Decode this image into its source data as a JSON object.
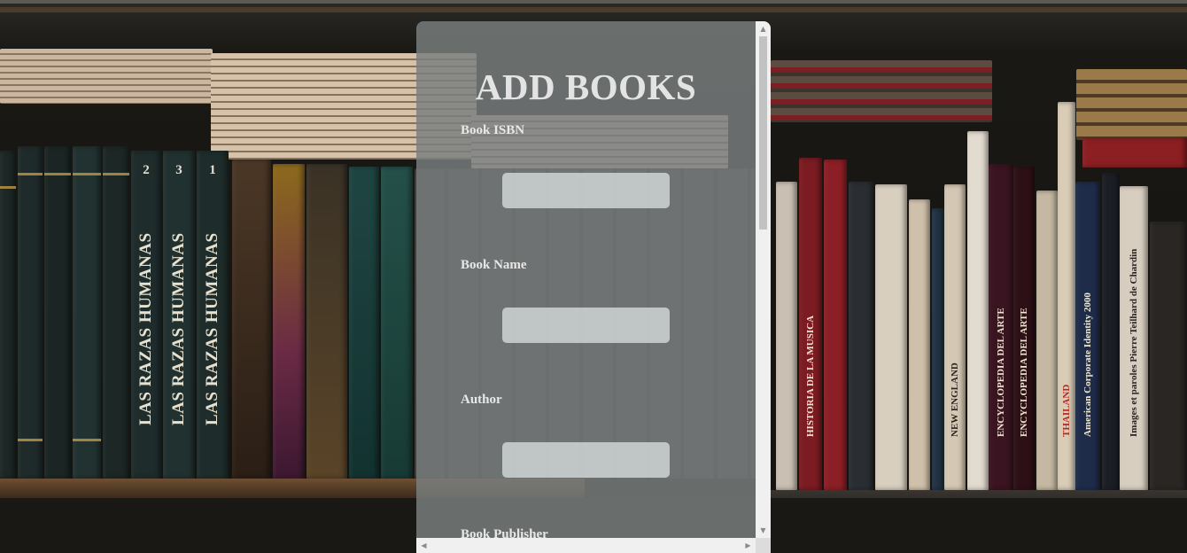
{
  "form": {
    "title": "ADD BOOKS",
    "fields": [
      {
        "label": "Book ISBN",
        "value": ""
      },
      {
        "label": "Book Name",
        "value": ""
      },
      {
        "label": "Author",
        "value": ""
      },
      {
        "label": "Book Publisher",
        "value": ""
      }
    ]
  },
  "scrollbar": {
    "up_icon": "triangle-up",
    "down_icon": "triangle-down",
    "left_icon": "triangle-left",
    "right_icon": "triangle-right"
  },
  "background": {
    "spine_titles": [
      "LAS RAZAS HUMANAS",
      "LAS RAZAS HUMANAS",
      "LAS RAZAS HUMANAS",
      "HISTORIA DE LA MUSICA",
      "NEW ENGLAND",
      "ENCYCLOPEDIA DEL ARTE",
      "ENCYCLOPEDIA DEL ARTE",
      "THAILAND",
      "American Corporate Identity 2000",
      "Images et paroles Pierre Teilhard de Chardin"
    ],
    "spine_numbers": [
      "2",
      "3",
      "1"
    ]
  }
}
